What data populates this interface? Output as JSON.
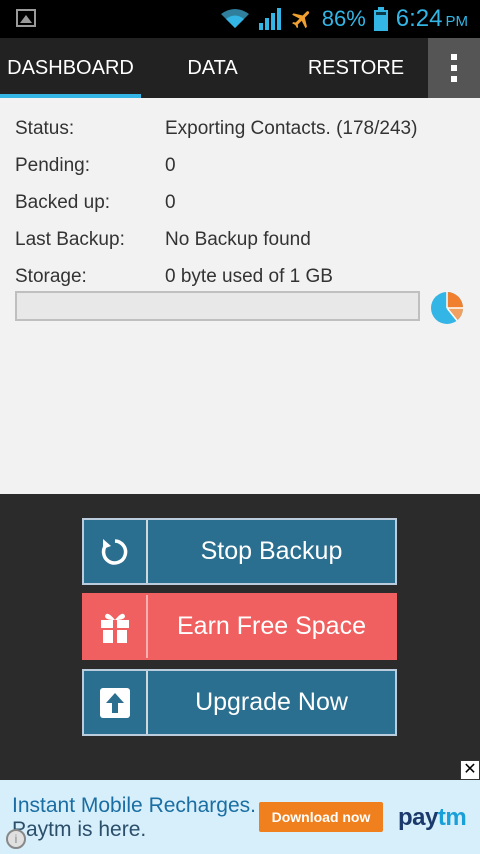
{
  "status_bar": {
    "battery_percent": "86%",
    "time": "6:24",
    "ampm": "PM",
    "icons": [
      "image-icon",
      "wifi-icon",
      "signal-icon",
      "airplane-icon",
      "battery-icon"
    ]
  },
  "tabs": [
    {
      "label": "DASHBOARD",
      "active": true
    },
    {
      "label": "DATA",
      "active": false
    },
    {
      "label": "RESTORE",
      "active": false
    }
  ],
  "dashboard": {
    "status_label": "Status:",
    "status_value": "Exporting Contacts. (178/243)",
    "pending_label": "Pending:",
    "pending_value": "0",
    "backed_up_label": "Backed up:",
    "backed_up_value": "0",
    "last_backup_label": "Last Backup:",
    "last_backup_value": "No Backup found",
    "storage_label": "Storage:",
    "storage_value": "0 byte used of 1 GB",
    "storage_used_fraction": 0
  },
  "actions": {
    "stop_backup": "Stop Backup",
    "earn_free_space": "Earn Free Space",
    "upgrade_now": "Upgrade Now"
  },
  "ad": {
    "line1": "Instant Mobile Recharges.",
    "line2": "Paytm is here.",
    "download_label": "Download now",
    "logo_text_1": "pay",
    "logo_text_2": "tm",
    "close_glyph": "✕",
    "info_glyph": "i"
  },
  "colors": {
    "accent": "#33b5e5",
    "blue_button": "#2a6f8f",
    "red_button": "#f06060",
    "ad_background": "#d7effa",
    "download_button": "#f07f1d"
  }
}
